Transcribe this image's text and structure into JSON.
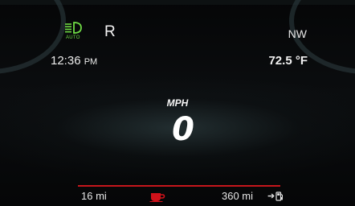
{
  "status": {
    "headlight_icon": "auto-headlight-icon",
    "headlight_mode": "AUTO",
    "gear": "R",
    "compass": "NW"
  },
  "info": {
    "time": "12:36",
    "ampm": "PM",
    "temperature": "72.5 °F"
  },
  "speed": {
    "unit": "MPH",
    "value": "0"
  },
  "bottom": {
    "range_left": "16 mi",
    "coffee_icon": "coffee-cup-icon",
    "range_right": "360 mi",
    "arrow_icon": "arrow-right-icon",
    "fuel_icon": "fuel-pump-icon"
  },
  "colors": {
    "indicator_green": "#6fdc45",
    "redline": "#c4161c",
    "coffee_red": "#d0121a"
  }
}
